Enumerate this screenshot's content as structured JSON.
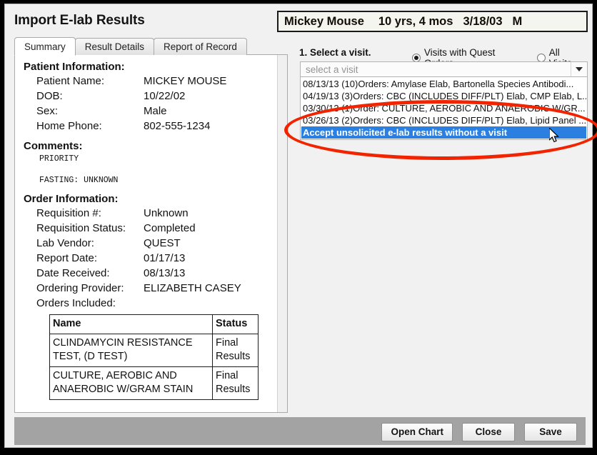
{
  "dialog": {
    "title": "Import E-lab Results"
  },
  "patient_banner": {
    "name": "Mickey Mouse",
    "age": "10 yrs, 4 mos",
    "dob": "3/18/03",
    "sex": "M"
  },
  "tabs": [
    {
      "label": "Summary",
      "active": true
    },
    {
      "label": "Result Details",
      "active": false
    },
    {
      "label": "Report of Record",
      "active": false
    }
  ],
  "summary": {
    "patient_information": {
      "heading": "Patient Information:",
      "rows": [
        {
          "label": "Patient Name:",
          "value": "MICKEY MOUSE"
        },
        {
          "label": "DOB:",
          "value": "10/22/02"
        },
        {
          "label": "Sex:",
          "value": "Male"
        },
        {
          "label": "Home Phone:",
          "value": "802-555-1234"
        }
      ]
    },
    "comments": {
      "heading": "Comments:",
      "lines": [
        "PRIORITY",
        "",
        "FASTING: UNKNOWN"
      ]
    },
    "order_information": {
      "heading": "Order Information:",
      "rows": [
        {
          "label": "Requisition #:",
          "value": "Unknown"
        },
        {
          "label": "Requisition Status:",
          "value": "Completed"
        },
        {
          "label": "Lab Vendor:",
          "value": "QUEST"
        },
        {
          "label": "Report Date:",
          "value": "01/17/13"
        },
        {
          "label": "Date Received:",
          "value": "08/13/13"
        },
        {
          "label": "Ordering Provider:",
          "value": "ELIZABETH CASEY"
        }
      ],
      "orders_included_label": "Orders Included:"
    },
    "orders_table": {
      "columns": [
        "Name",
        "Status"
      ],
      "rows": [
        {
          "name": "CLINDAMYCIN RESISTANCE TEST, (D TEST)",
          "status": "Final Results"
        },
        {
          "name": "CULTURE, AEROBIC AND ANAEROBIC W/GRAM STAIN",
          "status": "Final Results"
        }
      ]
    }
  },
  "visit_selector": {
    "step_label": "1. Select a visit.",
    "filters": [
      {
        "label": "Visits with Quest Orders",
        "checked": true
      },
      {
        "label": "All Visits",
        "checked": false
      }
    ],
    "combo_placeholder": "select a visit",
    "combo_value": "select a visit",
    "items": [
      {
        "text": "08/13/13 (10)Orders: Amylase Elab, Bartonella Species Antibodi...",
        "selected": false
      },
      {
        "text": "04/19/13 (3)Orders: CBC (INCLUDES DIFF/PLT) Elab, CMP Elab, L...",
        "selected": false
      },
      {
        "text": "03/30/13 (1)Order: CULTURE, AEROBIC AND ANAEROBIC W/GR...",
        "selected": false
      },
      {
        "text": "03/26/13 (2)Orders: CBC (INCLUDES DIFF/PLT) Elab, Lipid Panel ...",
        "selected": false
      },
      {
        "text": "Accept unsolicited e-lab results without a visit",
        "selected": true
      }
    ]
  },
  "footer": {
    "buttons": [
      {
        "label": "Open Chart"
      },
      {
        "label": "Close"
      },
      {
        "label": "Save"
      }
    ]
  },
  "annotation": {
    "color": "#f22400",
    "shape": "ellipse"
  }
}
